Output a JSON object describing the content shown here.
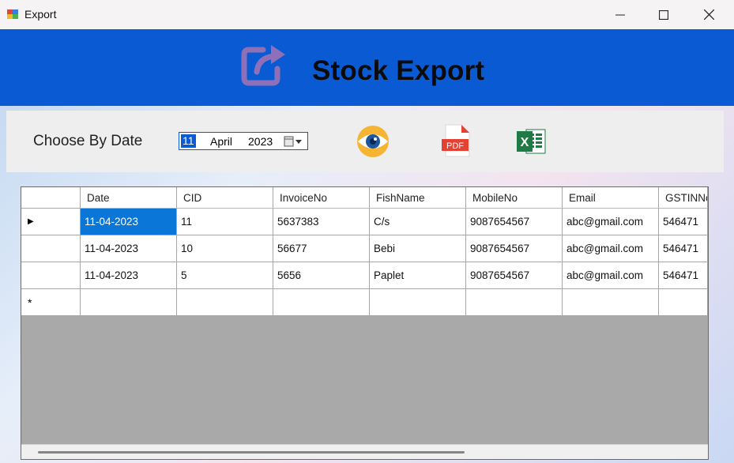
{
  "window": {
    "title": "Export",
    "minimize_glyph": "—",
    "maximize_glyph": "☐",
    "close_glyph": "✕"
  },
  "header": {
    "title": "Stock Export",
    "icon": "export-share-icon",
    "background": "#0a5bd3"
  },
  "filter": {
    "label": "Choose By Date",
    "date_day": "11",
    "date_month": "April",
    "date_year": "2023",
    "actions": [
      {
        "name": "view-icon"
      },
      {
        "name": "pdf-export-icon",
        "text": "PDF"
      },
      {
        "name": "excel-export-icon",
        "text": "X"
      }
    ]
  },
  "grid": {
    "columns": [
      "Date",
      "CID",
      "InvoiceNo",
      "FishName",
      "MobileNo",
      "Email",
      "GSTINNo"
    ],
    "rows": [
      [
        "11-04-2023",
        "11",
        "5637383",
        "C/s",
        "9087654567",
        "abc@gmail.com",
        "546471"
      ],
      [
        "11-04-2023",
        "10",
        "56677",
        "Bebi",
        "9087654567",
        "abc@gmail.com",
        "546471"
      ],
      [
        "11-04-2023",
        "5",
        "5656",
        "Paplet",
        "9087654567",
        "abc@gmail.com",
        "546471"
      ]
    ],
    "current_row_marker": "▶",
    "new_row_marker": "*",
    "selection_color": "#0a77d8"
  }
}
